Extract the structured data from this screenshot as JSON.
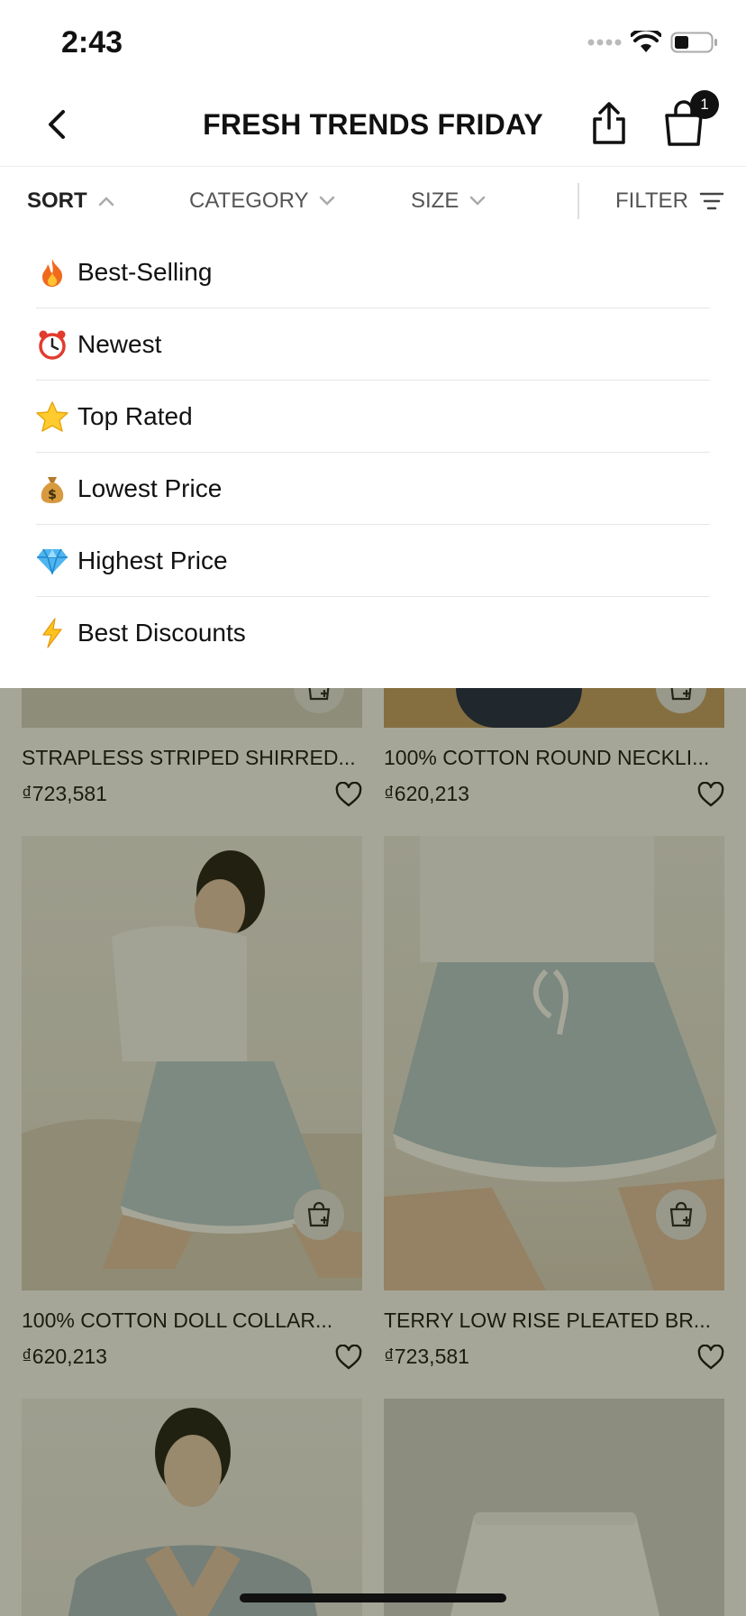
{
  "status_bar": {
    "time": "2:43"
  },
  "header": {
    "title": "FRESH TRENDS FRIDAY",
    "cart_count": "1"
  },
  "filter_bar": {
    "sort": "SORT",
    "category": "CATEGORY",
    "size": "SIZE",
    "filter": "FILTER"
  },
  "sort_menu": {
    "options": [
      {
        "icon": "fire-icon",
        "label": "Best-Selling"
      },
      {
        "icon": "alarm-clock-icon",
        "label": "Newest"
      },
      {
        "icon": "star-icon",
        "label": "Top Rated"
      },
      {
        "icon": "money-bag-icon",
        "label": "Lowest Price"
      },
      {
        "icon": "gem-icon",
        "label": "Highest Price"
      },
      {
        "icon": "lightning-icon",
        "label": "Best Discounts"
      }
    ]
  },
  "products": [
    {
      "name": "STRAPLESS STRIPED SHIRRED...",
      "price": "₫723,581"
    },
    {
      "name": "100% COTTON ROUND NECKLI...",
      "price": "₫620,213"
    },
    {
      "name": "100% COTTON DOLL COLLAR...",
      "price": "₫620,213"
    },
    {
      "name": "TERRY LOW RISE PLEATED BR...",
      "price": "₫723,581"
    }
  ]
}
